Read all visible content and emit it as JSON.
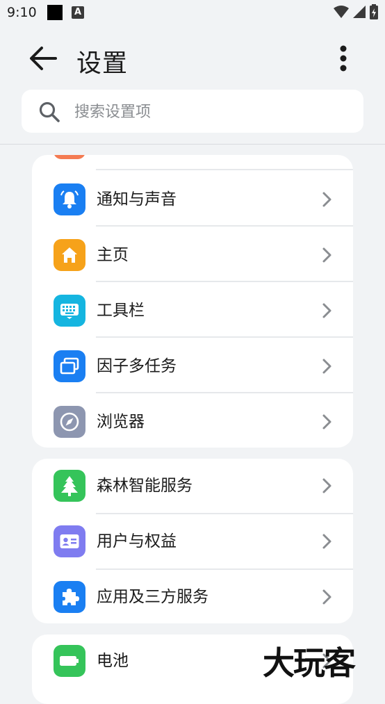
{
  "status_bar": {
    "time": "9:10",
    "notif_letter": "A"
  },
  "header": {
    "title": "设置"
  },
  "search": {
    "placeholder": "搜索设置项"
  },
  "groups": [
    {
      "items": [
        {
          "label": "通知与声音",
          "icon": "bell-icon",
          "color": "#1a7ff2"
        },
        {
          "label": "主页",
          "icon": "home-icon",
          "color": "#f6a21a"
        },
        {
          "label": "工具栏",
          "icon": "keyboard-icon",
          "color": "#15b5e0"
        },
        {
          "label": "因子多任务",
          "icon": "multitask-icon",
          "color": "#1a7ff2"
        },
        {
          "label": "浏览器",
          "icon": "compass-icon",
          "color": "#8d96b0"
        }
      ]
    },
    {
      "items": [
        {
          "label": "森林智能服务",
          "icon": "tree-icon",
          "color": "#35c45a"
        },
        {
          "label": "用户与权益",
          "icon": "id-card-icon",
          "color": "#7f7cf0"
        },
        {
          "label": "应用及三方服务",
          "icon": "puzzle-icon",
          "color": "#1a7ff2"
        }
      ]
    },
    {
      "items": [
        {
          "label": "电池",
          "icon": "battery-icon",
          "color": "#35c45a"
        }
      ]
    }
  ],
  "partial_top_item_color": "#f47b52",
  "watermark": "大玩客"
}
